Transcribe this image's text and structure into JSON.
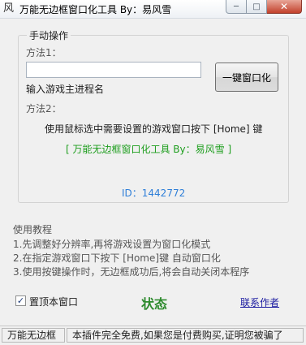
{
  "window": {
    "title": "万能无边框窗口化工具     By：易风雪",
    "icon": "风",
    "minimize_icon": "─",
    "maximize_icon": "□",
    "close_icon": "✕"
  },
  "manual_group": {
    "legend": "手动操作",
    "method1_label": "方法1：",
    "process_input_value": "",
    "process_input_placeholder": "",
    "process_hint": "输入游戏主进程名",
    "windowize_button": "一键窗口化",
    "method2_label": "方法2：",
    "method2_desc": "使用鼠标选中需要设置的游戏窗口按下 [Home] 键",
    "brand_line": "[ 万能无边框窗口化工具    By：易风雪 ]",
    "id_text": "ID：1442772"
  },
  "tutorial": {
    "heading": "使用教程",
    "steps": [
      "1.先调整好分辨率,再将游戏设置为窗口化模式",
      "2.在指定游戏窗口下按下 [Home]键 自动窗口化",
      "3.使用按键操作时，无边框成功后,将会自动关闭本程序"
    ]
  },
  "options": {
    "topmost_label": "置顶本窗口",
    "topmost_checked": true,
    "status_label": "状态",
    "contact_link": "联系作者"
  },
  "statusbar": {
    "pane1": "万能无边框",
    "pane2": "本插件完全免费,如果您是付费购买,证明您被骗了"
  },
  "colors": {
    "green_text": "#1e9e1e",
    "blue_text": "#2f7fd8",
    "status_green": "#2e8b2e",
    "link": "#1a1aa0",
    "close_button": "#c2412c"
  }
}
